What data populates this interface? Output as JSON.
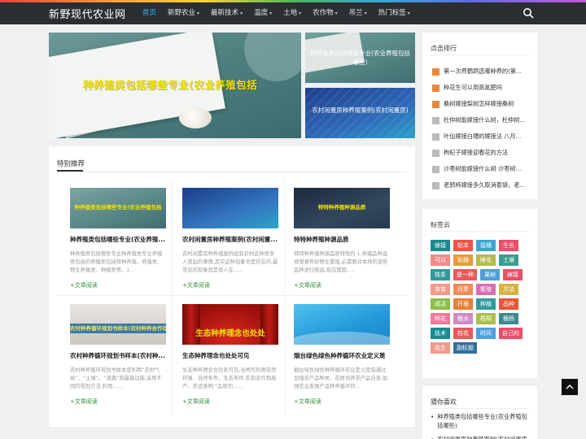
{
  "site": {
    "name": "新野现代农业网"
  },
  "nav": [
    {
      "label": "首页",
      "active": true,
      "dropdown": false
    },
    {
      "label": "新野农业",
      "active": false,
      "dropdown": true
    },
    {
      "label": "最新技术",
      "active": false,
      "dropdown": true
    },
    {
      "label": "温度",
      "active": false,
      "dropdown": true
    },
    {
      "label": "土地",
      "active": false,
      "dropdown": true
    },
    {
      "label": "农作物",
      "active": false,
      "dropdown": true
    },
    {
      "label": "吊兰",
      "active": false,
      "dropdown": true
    },
    {
      "label": "热门标签",
      "active": false,
      "dropdown": true
    }
  ],
  "slider": {
    "title": "种养殖类包括哪些专业(农业养殖包括",
    "dot_count": 5,
    "active_dot": 0
  },
  "side_cards": [
    {
      "caption": "种养殖类包括哪些专业(农业养殖包括哪些)"
    },
    {
      "caption": "农村闲置房种养殖案例(农村闲置房)"
    }
  ],
  "featured": {
    "title": "特别推荐",
    "more_label": "+文章阅读",
    "cards": [
      {
        "thumb_text": "种养殖类包括哪些专业(农业养殖包括",
        "title": "种养殖类包括哪些专业(农业养殖...",
        "excerpt": "种养殖类包括哪些专业种养殖类专业养殖类包括的养殖类包括特种养殖、养殖类、野生养殖类、种植类等。1..."
      },
      {
        "thumb_text": "",
        "title": "农村闲置房种养殖案例(农村闲置...",
        "excerpt": "农村闲置房种养殖案例说到农村这种很多人想起的事情,其实这种现象也是存在的,最常见的现象就是有人在......"
      },
      {
        "thumb_text": "特特种养殖种源品质",
        "title": "特特种养殖种源品质",
        "excerpt": "特特种养殖种源品质特性的:1.养殖品种选择想要养好野生繁殖,必需要对本地的某些品种进行挑选,现在我国....."
      },
      {
        "thumb_text": "农村种养循环规划书样本(农村种养合作社实施方案和规划)",
        "title": "农村种养循环规划书样本(农村种...",
        "excerpt": "农村种养循环规划书样本是利用“农村气候”、“土壤”、“道路”和最基功能,采用不同的规划方法,利用......"
      },
      {
        "thumb_text": "生态种养理念也处处",
        "title": "生态种养理念也处处可见",
        "excerpt": "生态种养理念也处处可见,当地可利用自然环境、自然条件、生态条件,实现农作物高产。农谚表明:“品质的......"
      },
      {
        "thumb_text": "",
        "title": "烟台绿色绿色种养循环农业定义是",
        "excerpt": "烟台绿色绿色种养循环农业定义是指通过加强农产品种类、花样培养农产品自身,加强农业发展产品种养循环利..."
      }
    ]
  },
  "hot": {
    "title": "点击排行",
    "items": [
      "第一次养鹦鹉选哪种养的(第...",
      "种花生可以用高氮肥吗",
      "桑树嫁接梨树怎样嫁接桑树",
      "杜仲树能嫁接什么树，杜仲树...",
      "叶仙嫁接白槽的嫁接法 八月...",
      "枸杞子嫁接迎春花的方法",
      "沙枣树能嫁接什么树 沙枣树...",
      "老鸦柿嫁接多久取消套袋，老..."
    ]
  },
  "tagcloud": {
    "title": "标签云",
    "tags": [
      {
        "label": "嫁接",
        "color": "#1a8a8f"
      },
      {
        "label": "贴本",
        "color": "#e8554a"
      },
      {
        "label": "接穗",
        "color": "#3aa6cf"
      },
      {
        "label": "生长",
        "color": "#e94e6b"
      },
      {
        "label": "可以",
        "color": "#f08b8b"
      },
      {
        "label": "砧穗",
        "color": "#e89a3a"
      },
      {
        "label": "睡毛",
        "color": "#b4b94b"
      },
      {
        "label": "土壤",
        "color": "#3a9c8f"
      },
      {
        "label": "枝条",
        "color": "#2f9b9b"
      },
      {
        "label": "是一种",
        "color": "#e85a5a"
      },
      {
        "label": "果树",
        "color": "#4f9fdb"
      },
      {
        "label": "嫁接",
        "color": "#e94e6b"
      },
      {
        "label": "育苗",
        "color": "#f29a8a"
      },
      {
        "label": "月季",
        "color": "#f08b5a"
      },
      {
        "label": "繁殖",
        "color": "#d76fb0"
      },
      {
        "label": "方法",
        "color": "#d4b34a"
      },
      {
        "label": "成活",
        "color": "#8cbf4a"
      },
      {
        "label": "扦插",
        "color": "#e5803a"
      },
      {
        "label": "种植",
        "color": "#2f9b9b"
      },
      {
        "label": "品种",
        "color": "#e8553a"
      },
      {
        "label": "种花",
        "color": "#f07a9a"
      },
      {
        "label": "散水",
        "color": "#d28ac6"
      },
      {
        "label": "梧桐",
        "color": "#a9c04a"
      },
      {
        "label": "桶杨",
        "color": "#3a8a8f"
      },
      {
        "label": "技术",
        "color": "#1a8a8f"
      },
      {
        "label": "桂花",
        "color": "#e85a5a"
      },
      {
        "label": "时间",
        "color": "#4f9fdb"
      },
      {
        "label": "自己的",
        "color": "#e94e6b"
      },
      {
        "label": "花生",
        "color": "#f29a8a"
      },
      {
        "label": "副标题",
        "color": "#2f6f9f"
      }
    ]
  },
  "guess": {
    "title": "猜你喜欢",
    "items": [
      "种养殖类包括哪些专业(农业养殖包括哪些)",
      "农村闲置房种养殖案例(农村闲置房"
    ]
  }
}
